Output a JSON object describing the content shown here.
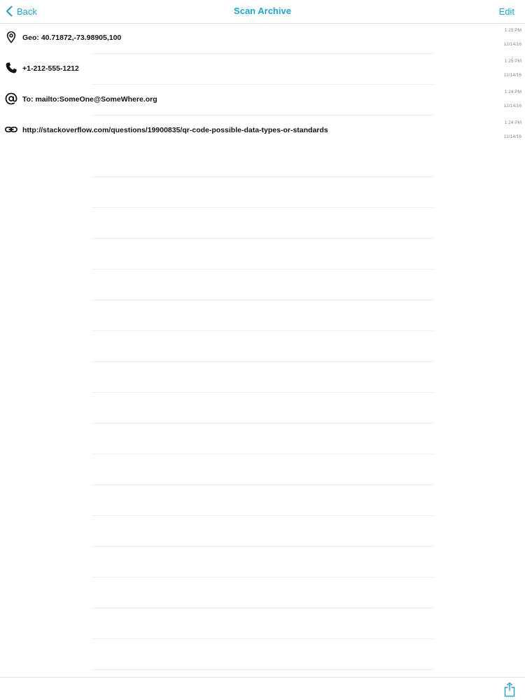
{
  "nav": {
    "back_label": "Back",
    "title": "Scan Archive",
    "edit_label": "Edit"
  },
  "records": [
    {
      "icon": "location-pin-icon",
      "text": "Geo: 40.71872,-73.98905,100",
      "time": "1:25 PM",
      "date": "12/14/16"
    },
    {
      "icon": "phone-icon",
      "text": "+1-212-555-1212",
      "time": "1:25 PM",
      "date": "12/14/16"
    },
    {
      "icon": "at-sign-icon",
      "text": "To: mailto:SomeOne@SomeWhere.org",
      "time": "1:24 PM",
      "date": "12/14/16"
    },
    {
      "icon": "link-icon",
      "text": "http://stackoverflow.com/questions/19900835/qr-code-possible-data-types-or-standards",
      "time": "1:24 PM",
      "date": "12/14/16"
    }
  ],
  "toolbar": {
    "share_icon": "share-icon"
  },
  "colors": {
    "accent": "#1ba6d9",
    "text": "#111111",
    "meta": "#8a8a8a",
    "separator": "#efefef"
  }
}
